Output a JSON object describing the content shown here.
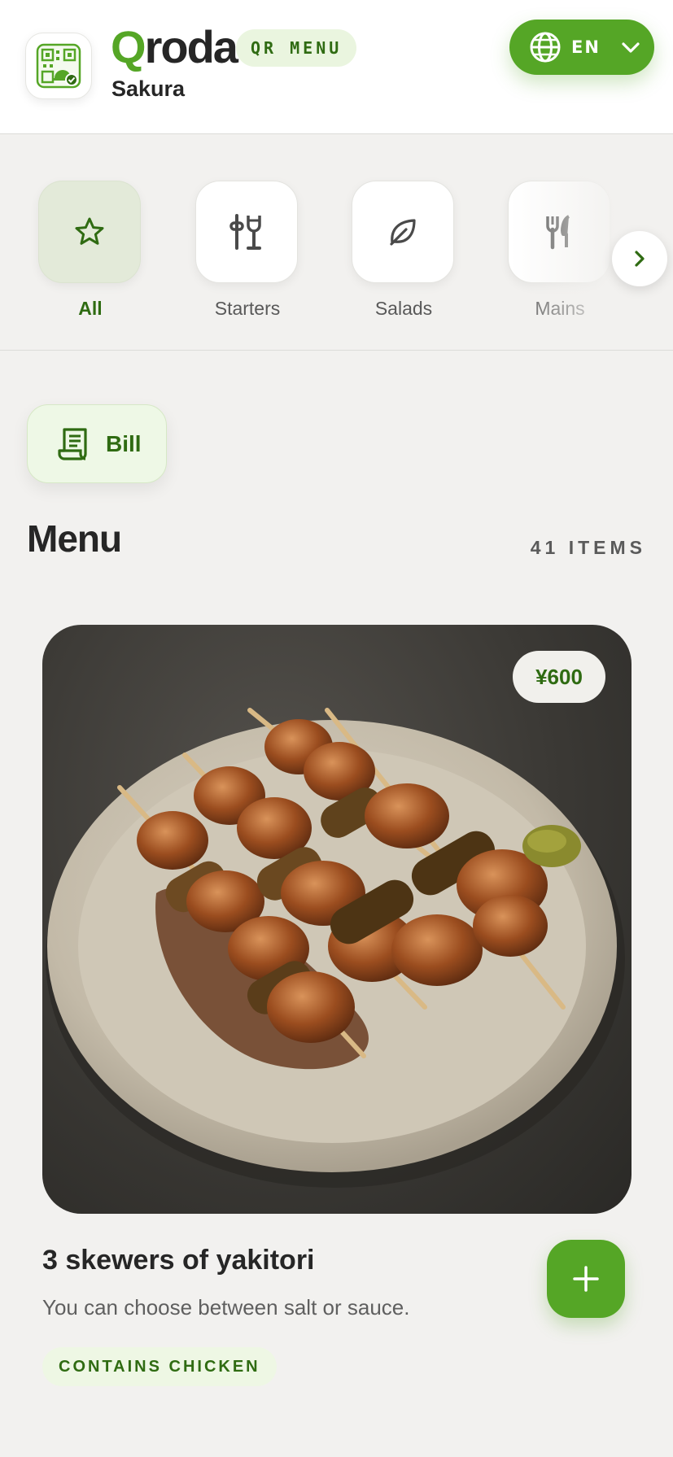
{
  "header": {
    "brand_first": "Q",
    "brand_rest": "roda",
    "badge": "QR MENU",
    "restaurant": "Sakura",
    "language": "EN",
    "icons": {
      "logo": "qr-dish-icon",
      "language": "globe-icon",
      "dropdown": "chevron-down-icon"
    }
  },
  "categories": [
    {
      "label": "All",
      "icon": "star-icon",
      "active": true
    },
    {
      "label": "Starters",
      "icon": "starters-icon",
      "active": false
    },
    {
      "label": "Salads",
      "icon": "leaf-icon",
      "active": false
    },
    {
      "label": "Mains",
      "icon": "fork-knife-icon",
      "active": false
    }
  ],
  "bill": {
    "label": "Bill",
    "icon": "receipt-icon"
  },
  "menu": {
    "title": "Menu",
    "count": "41 ITEMS",
    "items": [
      {
        "name": "3 skewers of yakitori",
        "description": "You can choose between salt or sauce.",
        "price": "¥600",
        "tag": "CONTAINS CHICKEN",
        "image": "yakitori-skewers-photo"
      }
    ]
  },
  "colors": {
    "accent": "#55a626",
    "accent_dark": "#2f6b12",
    "accent_soft": "#eaf5df",
    "background": "#f2f1ef"
  }
}
